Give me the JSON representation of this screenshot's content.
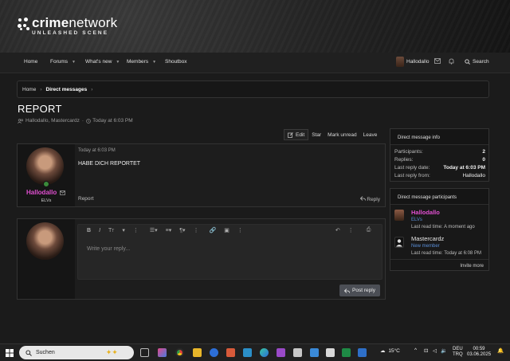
{
  "brand": {
    "name_bold": "crime",
    "name_thin": "network",
    "tagline": "UNLEASHED SCENE"
  },
  "nav": {
    "items": [
      {
        "label": "Home",
        "caret": false
      },
      {
        "label": "Forums",
        "caret": true
      },
      {
        "label": "What's new",
        "caret": true
      },
      {
        "label": "Members",
        "caret": true
      },
      {
        "label": "Shoutbox",
        "caret": false
      }
    ],
    "user": "Hallodallo",
    "search_label": "Search"
  },
  "breadcrumb": {
    "home": "Home",
    "current": "Direct messages"
  },
  "page": {
    "title": "REPORT",
    "participants": "Hallodallo, Mastercardz",
    "time": "Today at 6:03 PM"
  },
  "actions": {
    "edit": "Edit",
    "star": "Star",
    "mark_unread": "Mark unread",
    "leave": "Leave"
  },
  "message": {
    "author": "Hallodallo",
    "role": "ELVs",
    "time": "Today at 6:03 PM",
    "body": "HABE DICH REPORTET",
    "report": "Report",
    "reply": "Reply",
    "author_color": "#e04fd0"
  },
  "reply_box": {
    "placeholder": "Write your reply...",
    "post_label": "Post reply"
  },
  "info": {
    "title": "Direct message info",
    "rows": [
      {
        "label": "Participants:",
        "value": "2"
      },
      {
        "label": "Replies:",
        "value": "0"
      },
      {
        "label": "Last reply date:",
        "value": "Today at 6:03 PM"
      },
      {
        "label": "Last reply from:",
        "value": "Hallodallo"
      }
    ]
  },
  "participants": {
    "title": "Direct message participants",
    "list": [
      {
        "name": "Hallodallo",
        "role": "ELVs",
        "last_read": "Last read time: A moment ago",
        "name_color": "#e04fd0",
        "role_color": "#5a8fd8"
      },
      {
        "name": "Mastercardz",
        "role": "New member",
        "last_read": "Last read time: Today at 6:08 PM",
        "name_color": "#e6e6e6",
        "role_color": "#5a8fd8"
      }
    ],
    "invite": "Invite more"
  },
  "taskbar": {
    "search_placeholder": "Suchen",
    "weather": "15°C",
    "lang": "DEU",
    "lang_sub": "TRQ",
    "time": "00:59",
    "date": "03.06.2025"
  }
}
